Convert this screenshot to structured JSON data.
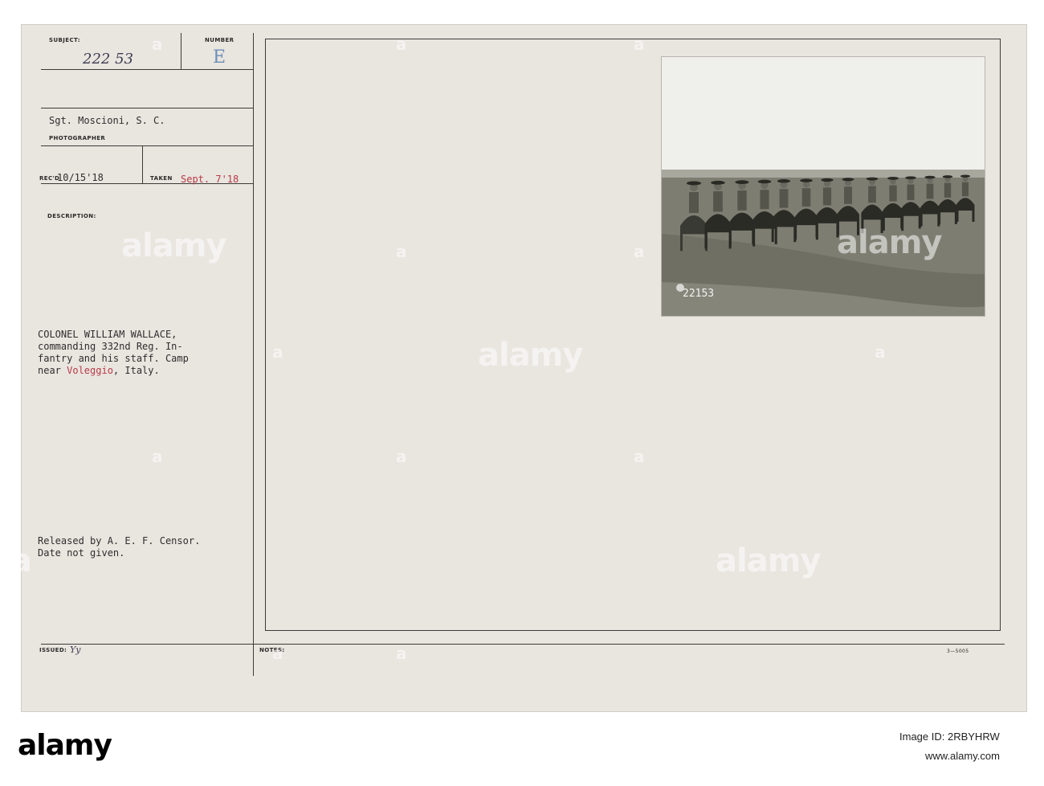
{
  "card": {
    "subject_label": "SUBJECT:",
    "number_label": "NUMBER",
    "subject_value": "222 53",
    "number_value": "E",
    "photographer": "Sgt. Moscioni, S. C.",
    "photographer_label": "PHOTOGRAPHER",
    "recd_label": "REC'D",
    "recd_value": "10/15'18",
    "taken_label": "TAKEN",
    "taken_value": "Sept. 7'18",
    "description_label": "DESCRIPTION:",
    "description_lines": [
      "COLONEL WILLIAM WALLACE,",
      "commanding 332nd Reg. In-",
      "fantry and his staff. Camp",
      "near Voleggio, Italy."
    ],
    "red_word": "Voleggio",
    "release_lines": [
      "Released by A. E. F. Censor.",
      "Date not given."
    ],
    "issued_label": "ISSUED:",
    "issued_value": "Yy",
    "notes_label": "NOTES:",
    "form_code": "3—5005",
    "photo_number": "22153"
  },
  "watermarks": [
    "alamy",
    "alamy",
    "alamy",
    "alamy",
    "alamy",
    "a"
  ],
  "footer": {
    "brand": "alamy",
    "image_id_line": "Image ID: 2RBYHRW",
    "url_line": "www.alamy.com"
  },
  "colors": {
    "card": "#e9e5df",
    "ink": "#2e2e2e",
    "red_ink": "#b83a47",
    "stamp_blue": "#6c8fb8"
  }
}
